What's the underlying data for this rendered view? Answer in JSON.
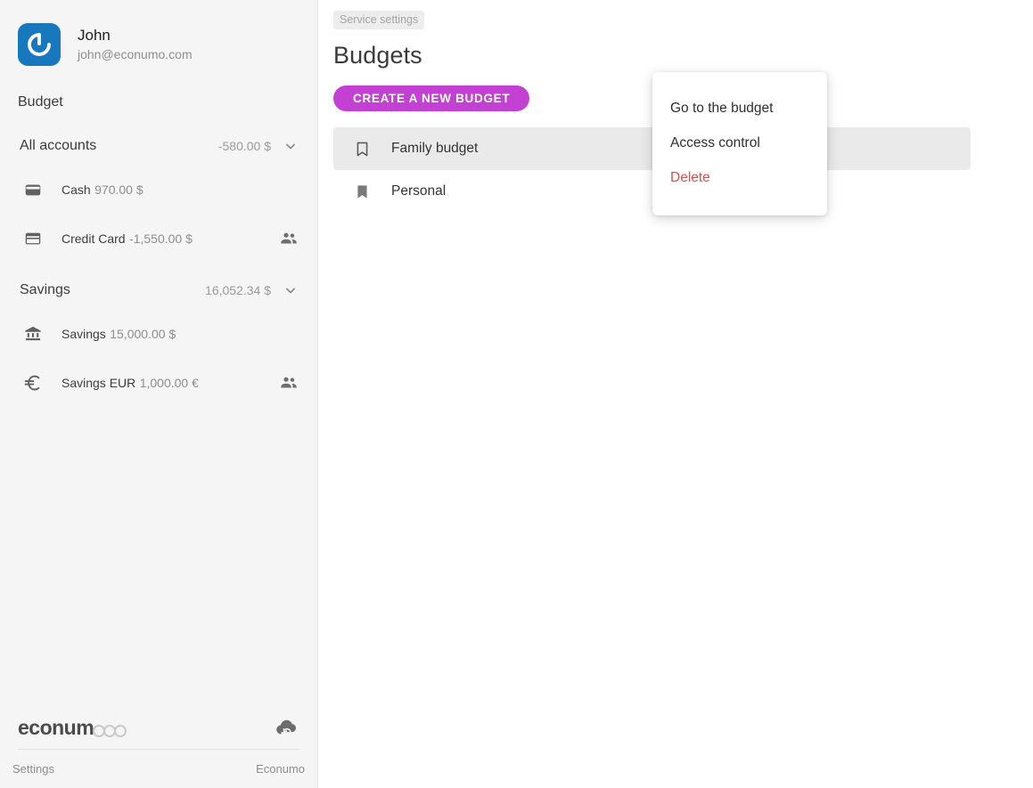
{
  "sidebar": {
    "profile": {
      "name": "John",
      "email": "john@econumo.com",
      "avatar_icon": "econumo-power-logo-icon",
      "avatar_color": "#1878bd"
    },
    "section_label": "Budget",
    "groups": [
      {
        "name": "All accounts",
        "amount": "-580.00 $",
        "chevron_icon": "chevron-down-icon",
        "accounts": [
          {
            "name": "Cash",
            "balance": "970.00 $",
            "icon": "wallet-icon",
            "shared": false
          },
          {
            "name": "Credit Card",
            "balance": "-1,550.00 $",
            "icon": "credit-card-icon",
            "shared": true,
            "share_icon": "people-icon"
          }
        ]
      },
      {
        "name": "Savings",
        "amount": "16,052.34 $",
        "chevron_icon": "chevron-down-icon",
        "accounts": [
          {
            "name": "Savings",
            "balance": "15,000.00 $",
            "icon": "bank-icon",
            "shared": false
          },
          {
            "name": "Savings EUR",
            "balance": "1,000.00 €",
            "icon": "euro-icon",
            "shared": true,
            "share_icon": "people-icon"
          }
        ]
      }
    ],
    "brand": {
      "word": "econum",
      "dots": 3,
      "sync_icon": "cloud-sync-icon"
    },
    "footer": {
      "settings_label": "Settings",
      "app_label": "Econumo"
    }
  },
  "main": {
    "breadcrumb_chip": "Service settings",
    "page_title": "Budgets",
    "create_button": "CREATE A NEW BUDGET",
    "create_button_color": "#c341d2",
    "budgets": [
      {
        "name": "Family budget",
        "icon": "bookmark-outline-icon",
        "selected": true
      },
      {
        "name": "Personal",
        "icon": "bookmark-filled-icon",
        "selected": false
      }
    ]
  },
  "context_menu": {
    "items": [
      {
        "label": "Go to the budget",
        "danger": false
      },
      {
        "label": "Access control",
        "danger": false
      },
      {
        "label": "Delete",
        "danger": true
      }
    ],
    "danger_color": "#e84a4a"
  }
}
